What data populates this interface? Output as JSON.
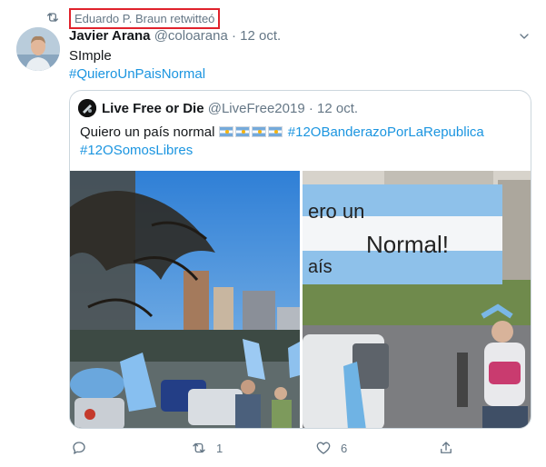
{
  "retweet": {
    "text": "Eduardo P. Braun retwitteó",
    "icon": "retweet-icon"
  },
  "tweet": {
    "author_name": "Javier Arana",
    "author_handle": "@coloarana",
    "separator": "·",
    "time": "12 oct.",
    "text": "SImple",
    "hashtag": "#QuieroUnPaisNormal"
  },
  "quote": {
    "author_name": "Live Free or Die",
    "author_handle": "@LiveFree2019",
    "separator": "·",
    "time": "12 oct.",
    "text_before_flags": "Quiero un país normal",
    "flag_count": 4,
    "hashtag_1": "#12OBanderazoPorLaRepublica",
    "hashtag_2": "#12OSomosLibres",
    "photo_sign": {
      "line1": "ero un",
      "line2": "Normal!",
      "line3": "aís"
    }
  },
  "actions": {
    "reply": {
      "icon": "reply-icon",
      "count": ""
    },
    "retweet": {
      "icon": "retweet-icon",
      "count": "1"
    },
    "like": {
      "icon": "heart-icon",
      "count": "6"
    },
    "share": {
      "icon": "share-icon",
      "count": ""
    }
  },
  "colors": {
    "link": "#1b95e0",
    "secondary_text": "#657786",
    "border": "#ccd6dd",
    "highlight_box": "#e0222c"
  }
}
